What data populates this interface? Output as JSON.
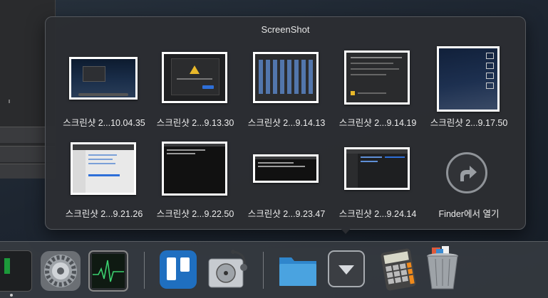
{
  "stack": {
    "title": "ScreenShot",
    "items": [
      {
        "label": "스크린샷 2...10.04.35",
        "icon": "screenshot-thumbnail"
      },
      {
        "label": "스크린샷 2...9.13.30",
        "icon": "screenshot-thumbnail"
      },
      {
        "label": "스크린샷 2...9.14.13",
        "icon": "screenshot-thumbnail"
      },
      {
        "label": "스크린샷 2...9.14.19",
        "icon": "screenshot-thumbnail"
      },
      {
        "label": "스크린샷 2...9.17.50",
        "icon": "screenshot-thumbnail"
      },
      {
        "label": "스크린샷 2...9.21.26",
        "icon": "screenshot-thumbnail"
      },
      {
        "label": "스크린샷 2...9.22.50",
        "icon": "screenshot-thumbnail"
      },
      {
        "label": "스크린샷 2...9.23.47",
        "icon": "screenshot-thumbnail"
      },
      {
        "label": "스크린샷 2...9.24.14",
        "icon": "screenshot-thumbnail"
      }
    ],
    "open_in_finder": {
      "label": "Finder에서 열기",
      "icon": "open-in-finder-arrow-icon"
    }
  },
  "dock": {
    "icons": [
      {
        "name": "app-icon-partial"
      },
      {
        "name": "system-preferences-icon"
      },
      {
        "name": "activity-monitor-icon"
      },
      {
        "name": "trello-icon"
      },
      {
        "name": "disk-utility-icon"
      },
      {
        "name": "folder-stack-icon"
      },
      {
        "name": "downloads-stack-icon"
      },
      {
        "name": "calculator-icon"
      },
      {
        "name": "trash-icon"
      }
    ]
  },
  "colors": {
    "popup_bg": "#2c2e32",
    "dock_bg": "#3c4046",
    "trello_blue": "#1f6fc0",
    "folder_blue": "#4aa3e0"
  }
}
